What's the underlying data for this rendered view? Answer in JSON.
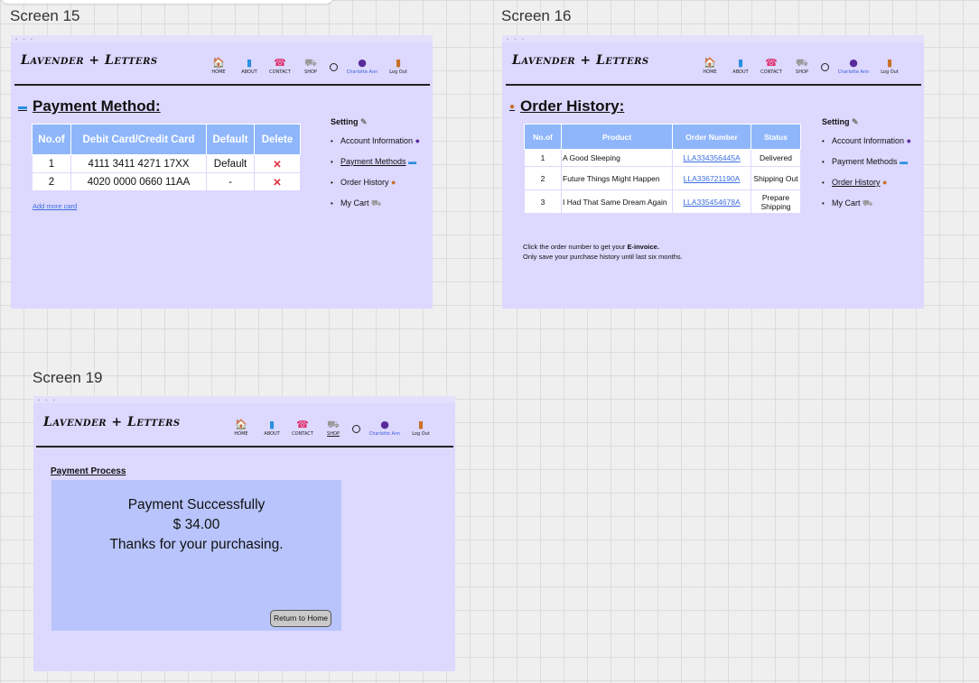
{
  "screens": [
    {
      "label": "Screen 15"
    },
    {
      "label": "Screen 16"
    },
    {
      "label": "Screen 19"
    }
  ],
  "brand": "Lavender + Letters",
  "nav": {
    "home": "HOME",
    "about": "ABOUT",
    "contact": "CONTACT",
    "shop": "SHOP",
    "user": "Charlotte Ann",
    "logout": "Log Out",
    "icons": {
      "home": "house-icon",
      "about": "book-icon",
      "contact": "phone-icon",
      "shop": "cart-icon",
      "search": "circle-icon",
      "user": "user-icon",
      "logout": "door-icon"
    }
  },
  "sidebar": {
    "title": "Setting",
    "items": [
      {
        "label": "Account Information"
      },
      {
        "label": "Payment Methods"
      },
      {
        "label": "Order History"
      },
      {
        "label": "My Cart"
      }
    ]
  },
  "payment_method": {
    "title": "Payment Method:",
    "headers": [
      "No.of",
      "Debit Card/Credit Card",
      "Default",
      "Delete"
    ],
    "rows": [
      {
        "no": "1",
        "card": "4111 3411 4271 17XX",
        "default": "Default",
        "delete": "✕"
      },
      {
        "no": "2",
        "card": "4020 0000 0660 11AA",
        "default": "-",
        "delete": "✕"
      }
    ],
    "add_card": "Add more card"
  },
  "order_history": {
    "title": "Order History:",
    "headers": [
      "No.of",
      "Product",
      "Order Number",
      "Status"
    ],
    "rows": [
      {
        "no": "1",
        "product": "A Good Sleeping",
        "order": "LLA334356445A",
        "status": "Delivered"
      },
      {
        "no": "2",
        "product": "Future Things Might Happen",
        "order": "LLA336721190A",
        "status": "Shipping Out"
      },
      {
        "no": "3",
        "product": "I Had That Same Dream Again",
        "order": "LLA335454678A",
        "status": "Prepare Shipping"
      }
    ],
    "note1_prefix": "Click the order number to get your ",
    "note1_bold": "E-invoice.",
    "note2": "Only save your purchase history until last six months."
  },
  "payment_process": {
    "title": "Payment Process",
    "line1": "Payment Successfully",
    "line2": "$ 34.00",
    "line3": "Thanks for your purchasing.",
    "button": "Return to Home"
  },
  "colors": {
    "frame_bg": "#dcd8fe",
    "table_header": "#8fb6fb",
    "panel": "#b8c4fb",
    "link": "#3b6ee0",
    "delete": "#e0303e"
  }
}
